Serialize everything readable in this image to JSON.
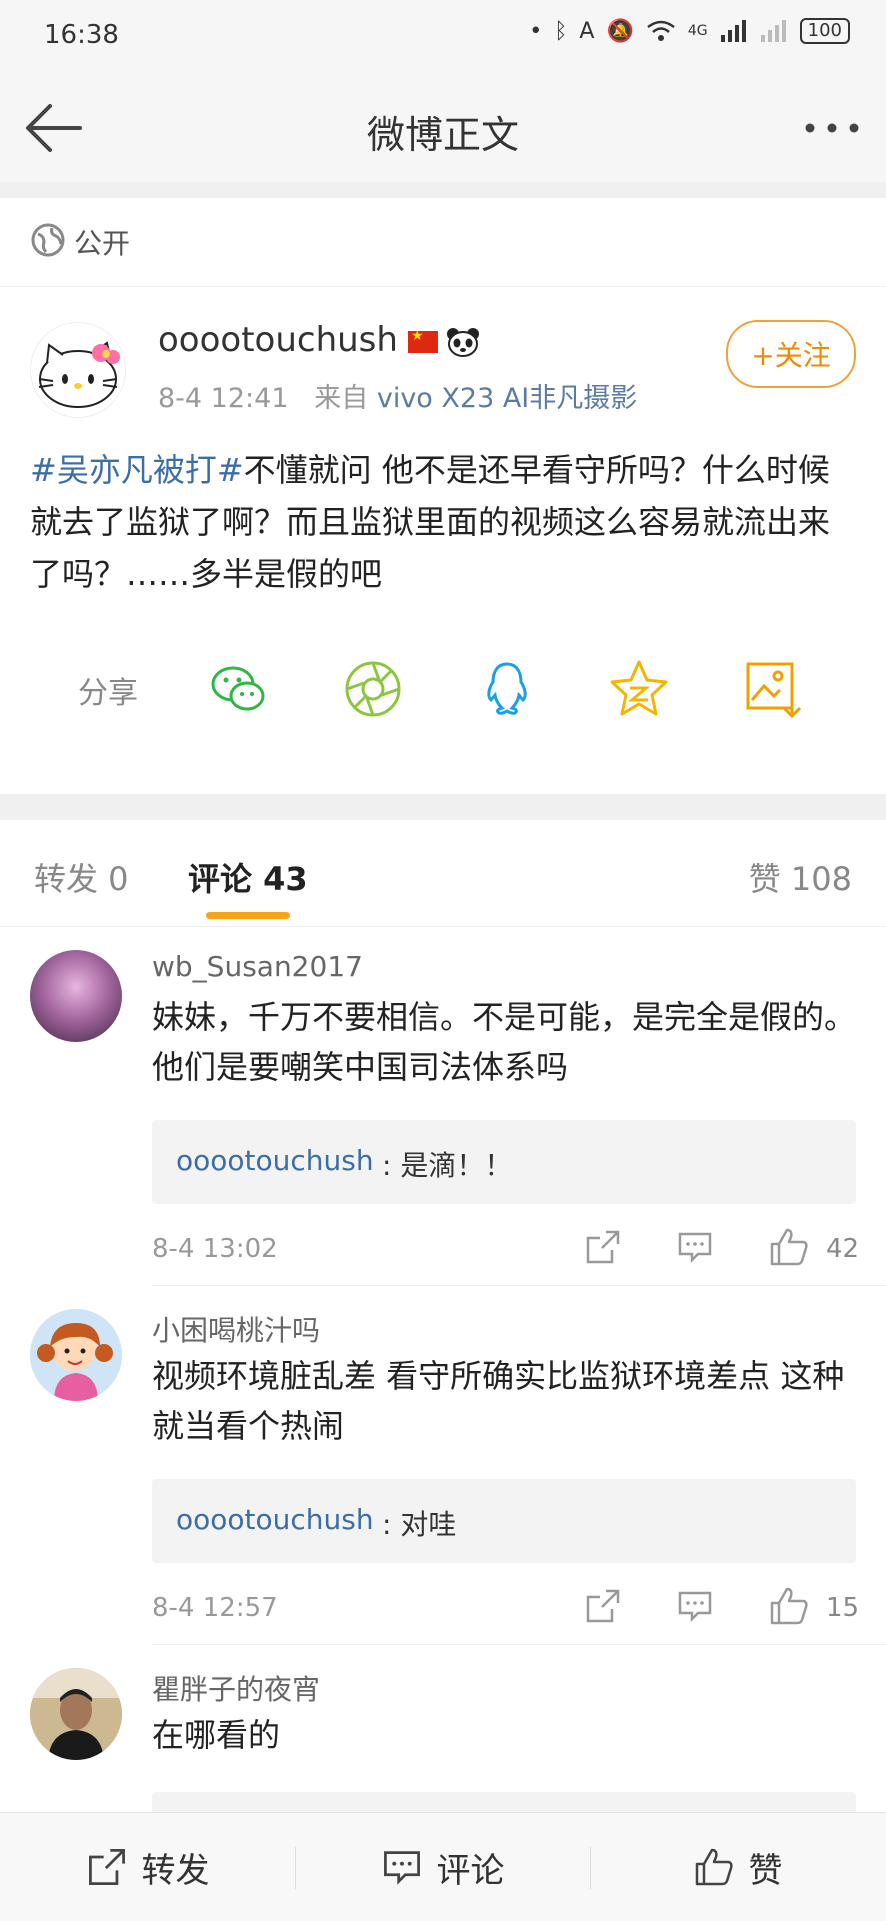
{
  "status": {
    "time": "16:38",
    "network": "4G",
    "battery": "100"
  },
  "nav": {
    "title": "微博正文"
  },
  "visibility": {
    "label": "公开"
  },
  "post": {
    "author": "ooootouchush",
    "time": "8-4 12:41",
    "source_prefix": "来自",
    "source": "vivo X23 AI非凡摄影",
    "follow_label": "+关注",
    "hashtag": "#吴亦凡被打#",
    "text": "不懂就问 他不是还早看守所吗？什么时候就去了监狱了啊？而且监狱里面的视频这么容易就流出来了吗？……多半是假的吧",
    "share_label": "分享",
    "share_icons": [
      "wechat-icon",
      "moments-icon",
      "qq-icon",
      "qzone-icon",
      "save-image-icon"
    ]
  },
  "tabs": {
    "forward": "转发 0",
    "comments": "评论 43",
    "likes": "赞 108"
  },
  "comments": [
    {
      "name": "wb_Susan2017",
      "text": "妹妹，千万不要相信。不是可能，是完全是假的。他们是要嘲笑中国司法体系吗",
      "reply_user": "ooootouchush",
      "reply_text": ": 是滴！！",
      "time": "8-4 13:02",
      "likes": "42"
    },
    {
      "name": "小困喝桃汁吗",
      "text": "视频环境脏乱差 看守所确实比监狱环境差点 这种就当看个热闹",
      "reply_user": "ooootouchush",
      "reply_text": ": 对哇",
      "time": "8-4 12:57",
      "likes": "15"
    },
    {
      "name": "瞿胖子的夜宵",
      "text": "在哪看的"
    }
  ],
  "bottom": {
    "forward": "转发",
    "comment": "评论",
    "like": "赞"
  },
  "colors": {
    "accent": "#f7a41a",
    "link": "#3c6ea6",
    "follow": "#f08a00"
  }
}
